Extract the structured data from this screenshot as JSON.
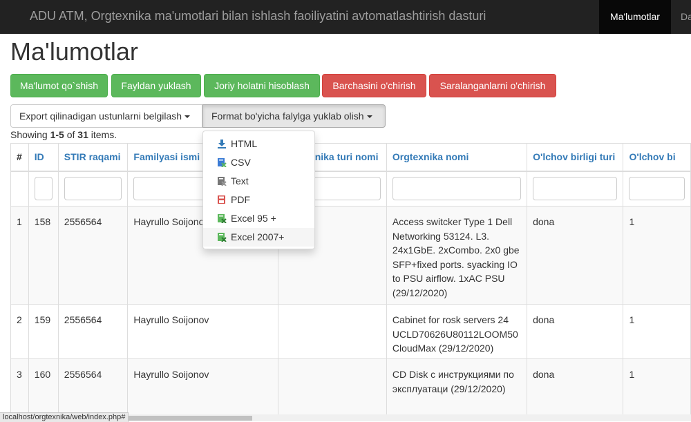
{
  "navbar": {
    "brand": "ADU ATM, Orgtexnika ma'umotlari bilan ishlash faoiliyatini avtomatlashtirish dasturi",
    "items": [
      {
        "label": "Ma'lumotlar",
        "active": true
      },
      {
        "label": "Da"
      }
    ]
  },
  "page": {
    "title": "Ma'lumotlar"
  },
  "actions": {
    "add": "Ma'lumot qo`shish",
    "upload": "Fayldan yuklash",
    "calculate": "Joriy holatni hisoblash",
    "delete_all": "Barchasini o'chirish",
    "delete_selected": "Saralanganlarni o'chirish"
  },
  "export": {
    "columns_button": "Export qilinadigan ustunlarni belgilash",
    "format_button": "Format bo'yicha falylga yuklab olish",
    "menu": [
      {
        "label": "HTML",
        "icon": "download-icon",
        "color": "#337ab7"
      },
      {
        "label": "CSV",
        "icon": "file-csv-icon",
        "color": "#3a7bd5"
      },
      {
        "label": "Text",
        "icon": "file-text-icon",
        "color": "#777777"
      },
      {
        "label": "PDF",
        "icon": "file-pdf-icon",
        "color": "#d9534f"
      },
      {
        "label": "Excel 95 +",
        "icon": "file-excel-icon",
        "color": "#5cb85c"
      },
      {
        "label": "Excel 2007+",
        "icon": "file-excel-icon",
        "color": "#5cb85c"
      }
    ]
  },
  "summary": {
    "prefix": "Showing ",
    "range": "1-5",
    "middle": " of ",
    "total": "31",
    "suffix": " items."
  },
  "table": {
    "headers": [
      "#",
      "ID",
      "STIR raqami",
      "Familyasi ismi",
      "Orgtexnika turi nomi",
      "Orgtexnika nomi",
      "O'lchov birligi turi",
      "O'lchov bi"
    ],
    "rows": [
      [
        "1",
        "158",
        "2556564",
        "Hayrullo Soijonov",
        "",
        "Access switcker Type 1 Dell Networking 53124. L3. 24x1GbE. 2xCombo. 2x0 gbe SFP+fixed ports. syacking IO to PSU airflow. 1xAC PSU (29/12/2020)",
        "dona",
        "1"
      ],
      [
        "2",
        "159",
        "2556564",
        "Hayrullo Soijonov",
        "",
        "Cabinet for rosk servers 24 UCLD70626U80112LOOM50 CloudMax (29/12/2020)",
        "dona",
        "1"
      ],
      [
        "3",
        "160",
        "2556564",
        "Hayrullo Soijonov",
        "",
        "CD Disk с инструкциями по эксплуатаци (29/12/2020)",
        "dona",
        "1"
      ]
    ]
  },
  "status": {
    "url": "localhost/orgtexnika/web/index.php#"
  },
  "colors": {
    "navbar": "#222222",
    "success": "#5cb85c",
    "danger": "#d9534f",
    "link": "#337ab7"
  }
}
